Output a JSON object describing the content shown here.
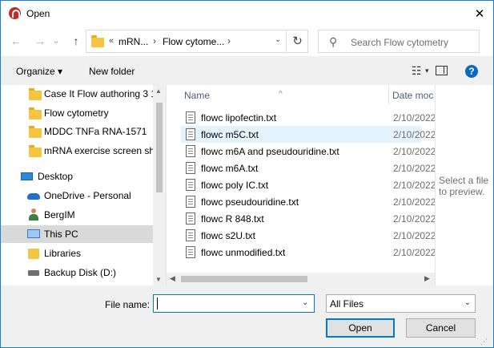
{
  "window": {
    "title": "Open",
    "close_glyph": "✕"
  },
  "nav": {
    "back_glyph": "←",
    "forward_glyph": "→",
    "recent_glyph": "⌄",
    "up_glyph": "↑",
    "address_overflow": "«",
    "address_segments": [
      "mRN...",
      "Flow cytome..."
    ],
    "address_separator": "›",
    "address_dropdown_glyph": "⌄",
    "refresh_glyph": "↻",
    "search_placeholder": "Search Flow cytometry",
    "search_glyph": "⚲"
  },
  "toolbar": {
    "organize_label": "Organize ▾",
    "new_folder_label": "New folder",
    "view_glyph": "☷",
    "view_dropdown_glyph": "▾",
    "help_glyph": "?"
  },
  "sidebar": {
    "scroll_up_glyph": "▲",
    "scroll_down_glyph": "▼",
    "items": [
      {
        "label": "Case It Flow authoring 3 1",
        "icon": "folder-icon"
      },
      {
        "label": "Flow cytometry",
        "icon": "folder-icon"
      },
      {
        "label": "MDDC TNFa RNA-1571",
        "icon": "folder-icon"
      },
      {
        "label": "mRNA exercise screen sho",
        "icon": "folder-icon"
      },
      {
        "label": "Desktop",
        "icon": "desktop-icon"
      },
      {
        "label": "OneDrive - Personal",
        "icon": "cloud-icon"
      },
      {
        "label": "BergIM",
        "icon": "user-icon"
      },
      {
        "label": "This PC",
        "icon": "computer-icon"
      },
      {
        "label": "Libraries",
        "icon": "library-icon"
      },
      {
        "label": "Backup Disk (D:)",
        "icon": "drive-icon"
      }
    ]
  },
  "filelist": {
    "columns": [
      "Name",
      "Date moc"
    ],
    "sort_glyph": "^",
    "scroll_left_glyph": "◀",
    "scroll_right_glyph": "▶",
    "rows": [
      {
        "name": "flowc lipofectin.txt",
        "date": "2/10/2022"
      },
      {
        "name": "flowc m5C.txt",
        "date": "2/10/2022"
      },
      {
        "name": "flowc m6A and pseudouridine.txt",
        "date": "2/10/2022"
      },
      {
        "name": "flowc m6A.txt",
        "date": "2/10/2022"
      },
      {
        "name": "flowc poly IC.txt",
        "date": "2/10/2022"
      },
      {
        "name": "flowc pseudouridine.txt",
        "date": "2/10/2022"
      },
      {
        "name": "flowc R 848.txt",
        "date": "2/10/2022"
      },
      {
        "name": "flowc s2U.txt",
        "date": "2/10/2022"
      },
      {
        "name": "flowc unmodified.txt",
        "date": "2/10/2022"
      }
    ]
  },
  "preview": {
    "line1": "Select a file",
    "line2": "to preview."
  },
  "bottom": {
    "filename_label": "File name:",
    "filename_value": "",
    "filename_dropdown_glyph": "⌄",
    "filter_value": "All Files",
    "filter_dropdown_glyph": "⌄",
    "open_label": "Open",
    "cancel_label": "Cancel",
    "grip_glyph": "⋰"
  }
}
